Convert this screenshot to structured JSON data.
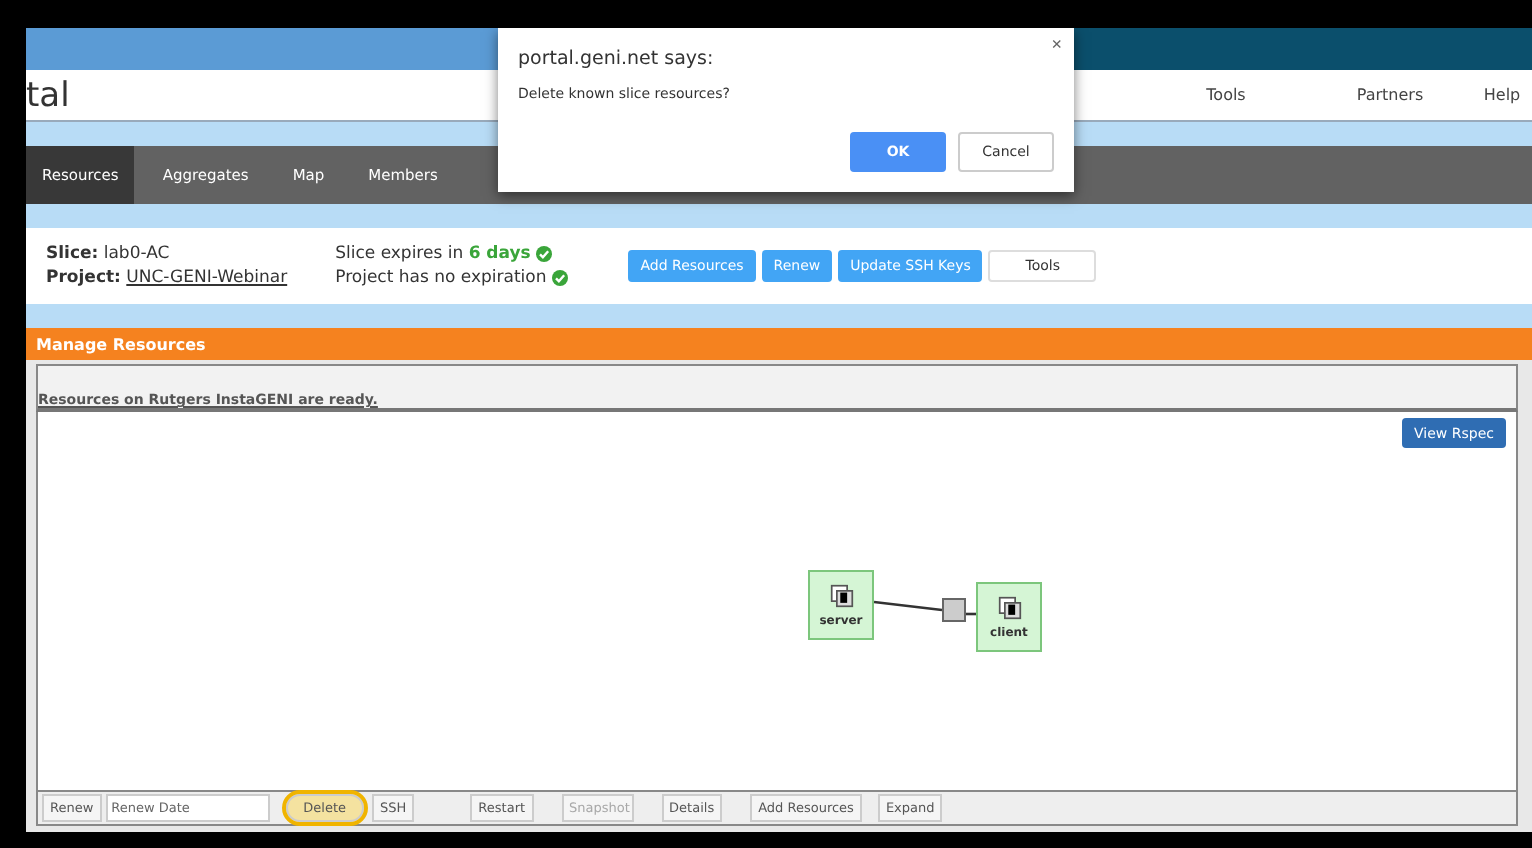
{
  "header": {
    "title_fragment": "tal",
    "nav": [
      "Tools",
      "Partners",
      "Help"
    ]
  },
  "tabs": [
    {
      "label": "Resources",
      "selected": true
    },
    {
      "label": "Aggregates",
      "selected": false
    },
    {
      "label": "Map",
      "selected": false
    },
    {
      "label": "Members",
      "selected": false
    }
  ],
  "slice_info": {
    "slice_label": "Slice:",
    "slice_name": "lab0-AC",
    "project_label": "Project:",
    "project_name": "UNC-GENI-Webinar",
    "expiry_prefix": "Slice expires in",
    "expiry_value": "6 days",
    "project_expiry": "Project has no expiration"
  },
  "slice_actions": [
    {
      "label": "Add Resources",
      "kind": "primary"
    },
    {
      "label": "Renew",
      "kind": "primary"
    },
    {
      "label": "Update SSH Keys",
      "kind": "primary"
    },
    {
      "label": "Tools",
      "kind": "plain"
    }
  ],
  "section_title": "Manage Resources",
  "status_message": "Resources on Rutgers InstaGENI are ready.",
  "view_rspec": "View Rspec",
  "nodes": [
    {
      "name": "server"
    },
    {
      "name": "client"
    }
  ],
  "toolbar": {
    "renew_label": "Renew",
    "renew_placeholder": "Renew Date",
    "buttons": [
      {
        "label": "Delete",
        "disabled": false,
        "highlighted": true
      },
      {
        "label": "SSH",
        "disabled": false,
        "highlighted": false
      },
      {
        "label": "Restart",
        "disabled": false,
        "highlighted": false
      },
      {
        "label": "Snapshot",
        "disabled": true,
        "highlighted": false
      },
      {
        "label": "Details",
        "disabled": false,
        "highlighted": false
      },
      {
        "label": "Add Resources",
        "disabled": false,
        "highlighted": false
      },
      {
        "label": "Expand",
        "disabled": false,
        "highlighted": false
      }
    ]
  },
  "dialog": {
    "title": "portal.geni.net says:",
    "message": "Delete known slice resources?",
    "close": "×",
    "buttons": [
      {
        "label": "OK",
        "kind": "primary"
      },
      {
        "label": "Cancel",
        "kind": "plain"
      }
    ]
  }
}
